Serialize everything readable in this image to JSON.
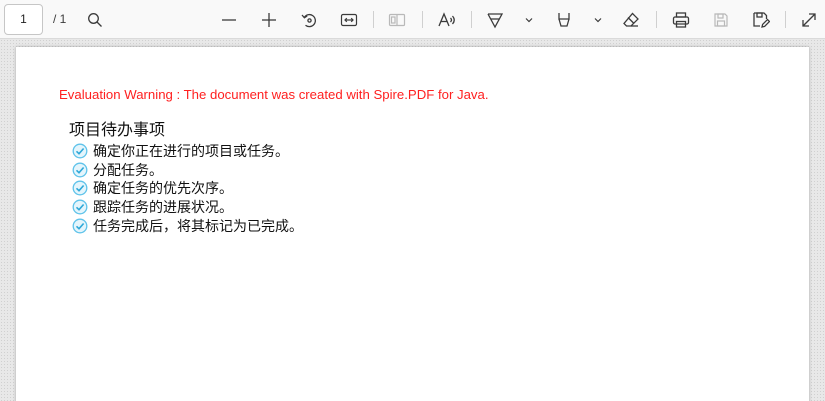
{
  "toolbar": {
    "page_number": "1",
    "page_total": "/ 1",
    "icons": [
      "search-icon",
      "zoom-out-icon",
      "zoom-in-icon",
      "rotate-icon",
      "fit-width-icon",
      "page-view-icon",
      "read-aloud-icon",
      "draw-icon",
      "chevron-down-icon",
      "highlight-icon",
      "chevron-down-icon",
      "eraser-icon",
      "print-icon",
      "save-icon",
      "save-as-icon",
      "expand-icon"
    ]
  },
  "document": {
    "evaluation_warning": "Evaluation Warning : The document was created with Spire.PDF for Java.",
    "title": "项目待办事项",
    "items": [
      "确定你正在进行的项目或任务。",
      "分配任务。",
      "确定任务的优先次序。",
      "跟踪任务的进展状况。",
      "任务完成后，将其标记为已完成。"
    ]
  },
  "colors": {
    "warning": "#ff2020",
    "checkbox": "#5fc3ea",
    "toolbar_bg": "#f9f9f9"
  }
}
